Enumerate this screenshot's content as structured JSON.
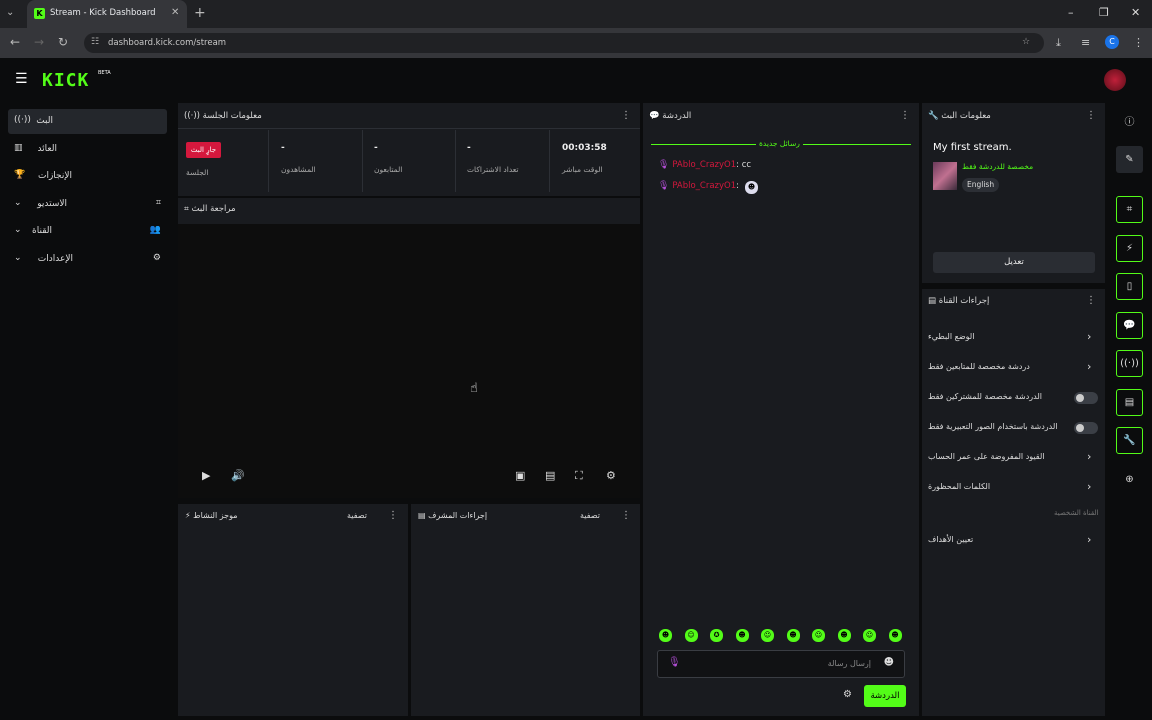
{
  "browser": {
    "tab_title": "Stream - Kick Dashboard",
    "url": "dashboard.kick.com/stream",
    "profile_initial": "C"
  },
  "app": {
    "logo": "KICK",
    "logo_badge": "BETA"
  },
  "sidebar": {
    "items": [
      {
        "label": "البث",
        "icon": "broadcast-icon",
        "selected": true
      },
      {
        "label": "العائد",
        "icon": "chart-icon"
      },
      {
        "label": "الإنجازات",
        "icon": "trophy-icon"
      },
      {
        "label": "الاستديو",
        "icon": "studio-icon",
        "expandable": true
      },
      {
        "label": "القناة",
        "icon": "users-icon",
        "expandable": true
      },
      {
        "label": "الإعدادات",
        "icon": "gear-icon",
        "expandable": true
      }
    ]
  },
  "session": {
    "title": "معلومات الجلسة",
    "live_badge": "جارٍ البث",
    "stats": [
      {
        "label": "الجلسة",
        "value": ""
      },
      {
        "label": "المشاهدون",
        "value": "-"
      },
      {
        "label": "المتابعون",
        "value": "-"
      },
      {
        "label": "تعداد الاشتراكات",
        "value": "-"
      },
      {
        "label": "الوقت مباشر",
        "value": "00:03:58"
      }
    ]
  },
  "preview": {
    "title": "مراجعة البث"
  },
  "activity": {
    "title": "موجز النشاط",
    "filter": "تصفية"
  },
  "mod_actions": {
    "title": "إجراءات المشرف",
    "filter": "تصفية"
  },
  "chat": {
    "title": "الدردشة",
    "new_messages": "رسائل جديدة",
    "messages": [
      {
        "user": "PAblo_CrazyO1",
        "text": "cc"
      },
      {
        "user": "PAblo_CrazyO1",
        "text": ""
      }
    ],
    "input_placeholder": "إرسال رسالة",
    "send_label": "الدردشة",
    "emote_count": 10
  },
  "stream_info": {
    "title": "معلومات البث",
    "stream_title": "My first stream.",
    "category": "مخصصة للدردشة فقط",
    "language": "English",
    "edit_label": "تعديل"
  },
  "channel_actions": {
    "title": "إجراءات القناة",
    "items": [
      {
        "label": "الوضع البطيء",
        "kind": "chevron"
      },
      {
        "label": "دردشة مخصصة للمتابعين فقط",
        "kind": "chevron"
      },
      {
        "label": "الدردشة مخصصة للمشتركين فقط",
        "kind": "toggle",
        "on": false
      },
      {
        "label": "الدردشة باستخدام الصور التعبيرية فقط",
        "kind": "toggle",
        "on": false
      },
      {
        "label": "القيود المفروضة على عمر الحساب",
        "kind": "chevron"
      },
      {
        "label": "الكلمات المحظورة",
        "kind": "chevron"
      }
    ],
    "section_label": "القناة الشخصية",
    "goals_label": "تعيين الأهداف"
  },
  "colors": {
    "accent": "#53fc18",
    "live": "#d4183d",
    "panel": "#191b1f"
  }
}
